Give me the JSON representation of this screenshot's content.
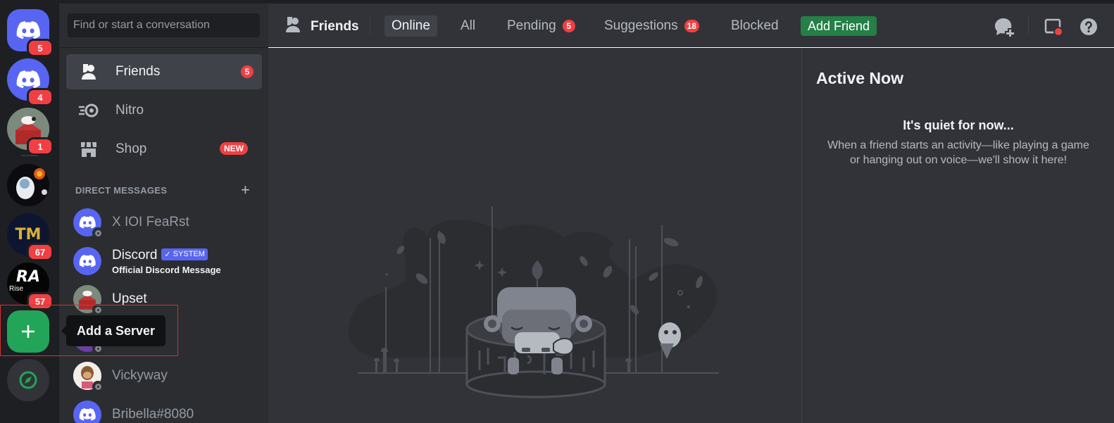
{
  "servers": [
    {
      "name": "Discord",
      "badge": "5"
    },
    {
      "name": "Discord",
      "badge": "4"
    },
    {
      "name": "Upset",
      "badge": "1"
    },
    {
      "name": "Astronaut",
      "badge": ""
    },
    {
      "name": "TM",
      "badge": "67",
      "initials": "TM"
    },
    {
      "name": "RiseA",
      "badge": "57",
      "initials": "RA",
      "subtext": "Rise"
    }
  ],
  "add_server": {
    "tooltip": "Add a Server"
  },
  "search": {
    "placeholder": "Find or start a conversation"
  },
  "sidebar_nav": [
    {
      "label": "Friends",
      "count": "5"
    },
    {
      "label": "Nitro"
    },
    {
      "label": "Shop",
      "tag": "NEW"
    }
  ],
  "direct_messages": {
    "heading": "DIRECT MESSAGES",
    "items": [
      {
        "name": "X IOI FeaRst"
      },
      {
        "name": "Discord",
        "tag": "SYSTEM",
        "subtitle": "Official Discord Message"
      },
      {
        "name": "Upset"
      },
      {
        "name": "Vickyway"
      },
      {
        "name": "Bribella#8080"
      }
    ]
  },
  "header": {
    "title": "Friends",
    "tabs": [
      {
        "label": "Online"
      },
      {
        "label": "All"
      },
      {
        "label": "Pending",
        "badge": "5"
      },
      {
        "label": "Suggestions",
        "badge": "18"
      },
      {
        "label": "Blocked"
      }
    ],
    "add_friend": "Add Friend"
  },
  "active_now": {
    "title": "Active Now",
    "quiet_title": "It's quiet for now...",
    "quiet_desc": "When a friend starts an activity—like playing a game or hanging out on voice—we'll show it here!"
  },
  "colors": {
    "blurple": "#5865f2",
    "green": "#23a559",
    "danger": "#f23f43",
    "bg": "#313338"
  }
}
